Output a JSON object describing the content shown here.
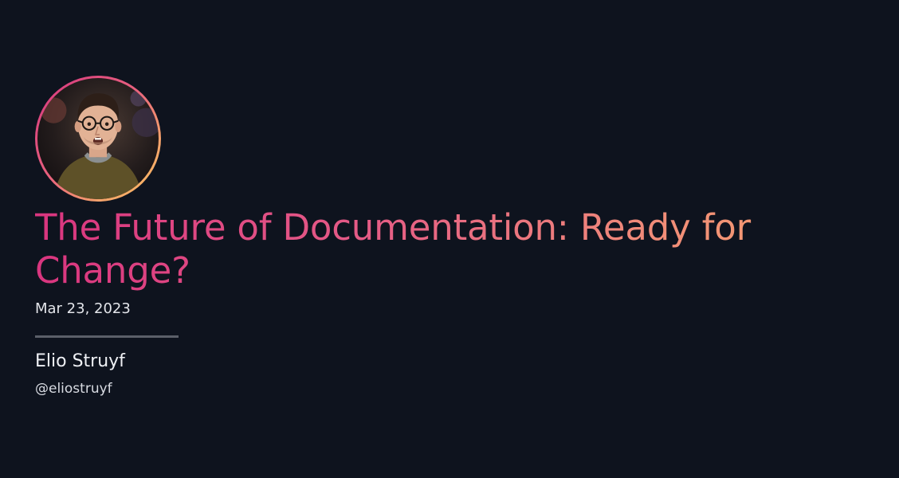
{
  "post": {
    "title": "The Future of Documentation: Ready for Change?",
    "date": "Mar 23, 2023"
  },
  "author": {
    "name": "Elio Struyf",
    "handle": "@eliostruyf",
    "avatar_icon": "author-photo"
  },
  "colors": {
    "background": "#0e131e",
    "title_gradient_start": "#d9357f",
    "title_gradient_end": "#f5a06e",
    "ring_gradient_end": "#f8c25e"
  }
}
